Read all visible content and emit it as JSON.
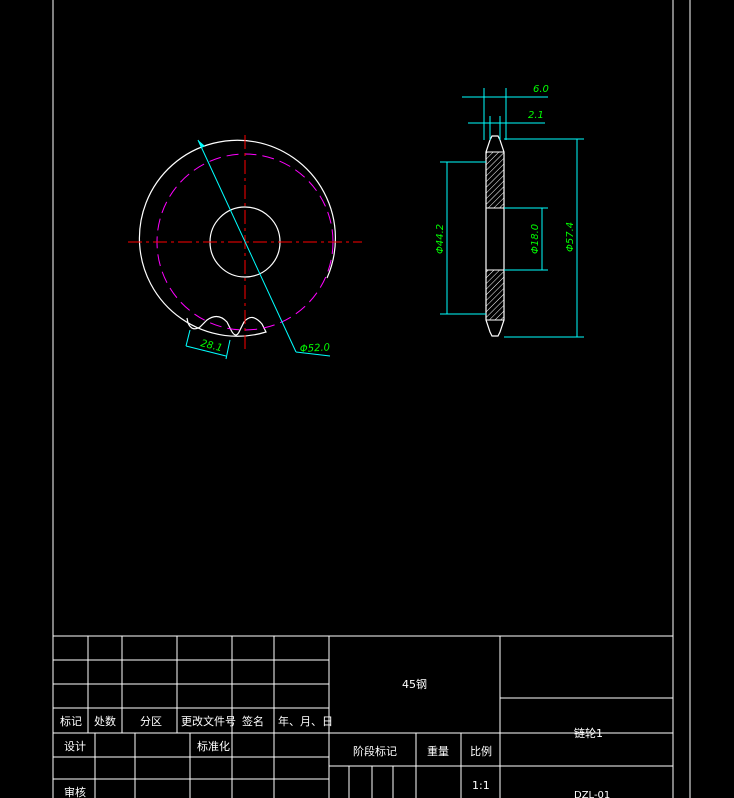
{
  "front_view": {
    "dim_outer_diameter": "Φ52.0",
    "dim_tooth_pitch": "28.1"
  },
  "side_view": {
    "dim_total_width": "6.0",
    "dim_tooth_width": "2.1",
    "dim_hub_diameter": "Φ44.2",
    "dim_bore_diameter": "Φ18.0",
    "dim_tip_diameter": "Φ57.4"
  },
  "title_block": {
    "col_mark": "标记",
    "col_count": "处数",
    "col_zone": "分区",
    "col_change_doc": "更改文件号",
    "col_signature": "签名",
    "col_date": "年、月、日",
    "row_design": "设计",
    "row_standardize": "标准化",
    "row_review": "审核",
    "material": "45钢",
    "stage_mark": "阶段标记",
    "weight": "重量",
    "scale": "比例",
    "scale_value": "1:1",
    "part_name": "链轮1",
    "drawing_no": "DZL-01"
  },
  "colors": {
    "line": "#ffffff",
    "dimension": "#00ffff",
    "dimension_text": "#00ff00",
    "centerline": "#ff0000",
    "pitch_circle": "#ff00ff"
  }
}
